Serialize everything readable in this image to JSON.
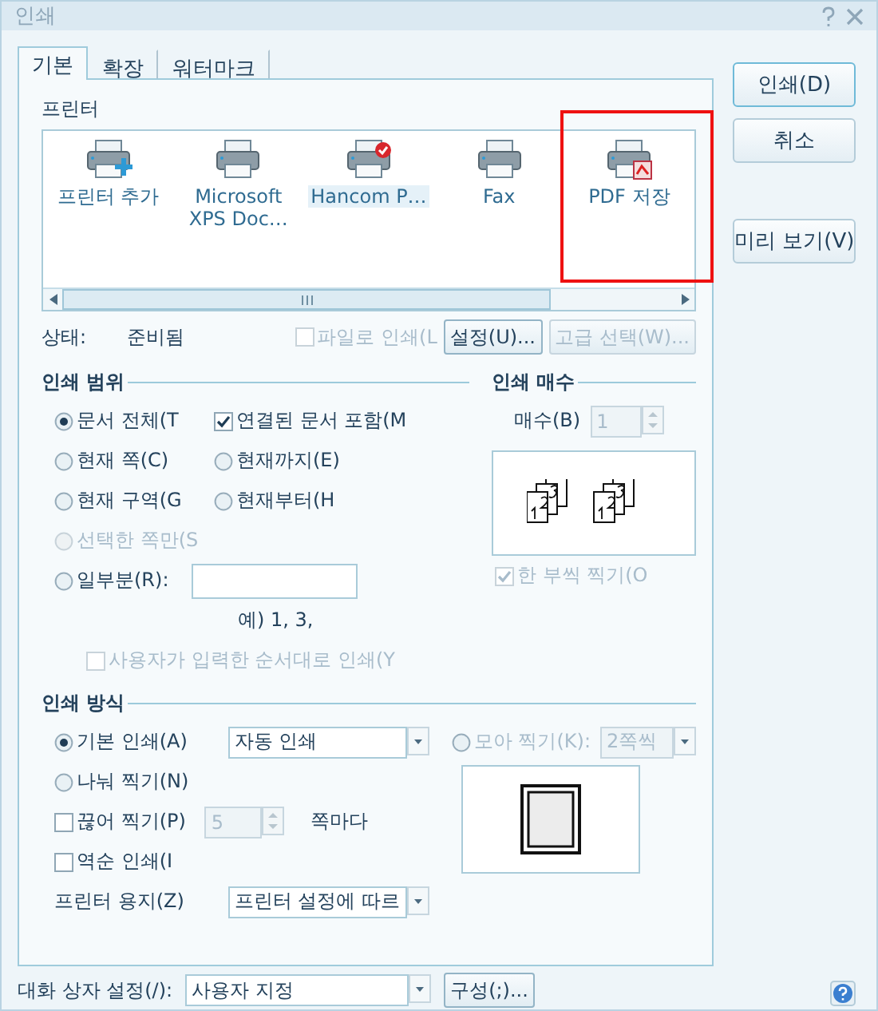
{
  "window": {
    "title": "인쇄"
  },
  "tabs": [
    {
      "label": "기본",
      "selected": true
    },
    {
      "label": "확장",
      "selected": false
    },
    {
      "label": "워터마크",
      "selected": false
    }
  ],
  "printer_section": {
    "label": "프린터"
  },
  "printers": [
    {
      "label": "프린터 추가",
      "kind": "add",
      "selected": false
    },
    {
      "label": "Microsoft XPS Doc…",
      "kind": "plain",
      "selected": false
    },
    {
      "label": "Hancom P…",
      "kind": "default",
      "selected": true
    },
    {
      "label": "Fax",
      "kind": "plain",
      "selected": false
    },
    {
      "label": "PDF 저장",
      "kind": "pdf",
      "selected": false,
      "highlighted": true
    }
  ],
  "status": {
    "label": "상태:",
    "value": "준비됨"
  },
  "print_to_file": {
    "label": "파일로 인쇄(L",
    "checked": false,
    "disabled": true
  },
  "printer_buttons": [
    {
      "label": "설정(U)...",
      "disabled": false
    },
    {
      "label": "고급 선택(W)...",
      "disabled": true
    }
  ],
  "range": {
    "title": "인쇄 범위",
    "options": [
      {
        "kind": "radio",
        "label": "문서 전체(T",
        "selected": true,
        "disabled": false
      },
      {
        "kind": "checkbox",
        "label": "연결된 문서 포함(M",
        "checked": true,
        "disabled": false
      },
      {
        "kind": "radio",
        "label": "현재 쪽(C)",
        "selected": false,
        "disabled": false
      },
      {
        "kind": "radio",
        "label": "현재까지(E)",
        "selected": false,
        "disabled": false
      },
      {
        "kind": "radio",
        "label": "현재 구역(G",
        "selected": false,
        "disabled": false
      },
      {
        "kind": "radio",
        "label": "현재부터(H",
        "selected": false,
        "disabled": false
      },
      {
        "kind": "radio",
        "label": "선택한 쪽만(S",
        "selected": false,
        "disabled": true
      }
    ],
    "partial": {
      "label": "일부분(R):",
      "selected": false
    },
    "hint": "예) 1, 3,",
    "user_order": {
      "label": "사용자가 입력한 순서대로 인쇄(Y",
      "checked": false,
      "disabled": true
    }
  },
  "copies": {
    "title": "인쇄 매수",
    "label": "매수(B)",
    "value": "1",
    "disabled": true,
    "collate": {
      "label": "한 부씩 찍기(O",
      "checked": true,
      "disabled": true
    }
  },
  "method": {
    "title": "인쇄 방식",
    "normal": {
      "label": "기본 인쇄(A)",
      "selected": true,
      "value": "자동 인쇄"
    },
    "nup": {
      "label": "모아 찍기(K):",
      "selected": false,
      "value": "2쪽씩",
      "disabled": true
    },
    "split": {
      "label": "나눠 찍기(N)",
      "selected": false
    },
    "chunk": {
      "label": "끊어 찍기(P)",
      "checked": false,
      "value": "5",
      "disabled": true,
      "suffix": "쪽마다"
    },
    "reverse": {
      "label": "역순 인쇄(I",
      "checked": false
    },
    "paper": {
      "label": "프린터 용지(Z)",
      "value": "프린터 설정에 따르"
    }
  },
  "dialog_setting": {
    "label": "대화 상자 설정(/):",
    "value": "사용자 지정",
    "button": "구성(;)..."
  },
  "actions": [
    {
      "label": "인쇄(D)",
      "default": true
    },
    {
      "label": "취소",
      "default": false
    },
    {
      "label": "미리 보기(V)",
      "default": false
    }
  ]
}
